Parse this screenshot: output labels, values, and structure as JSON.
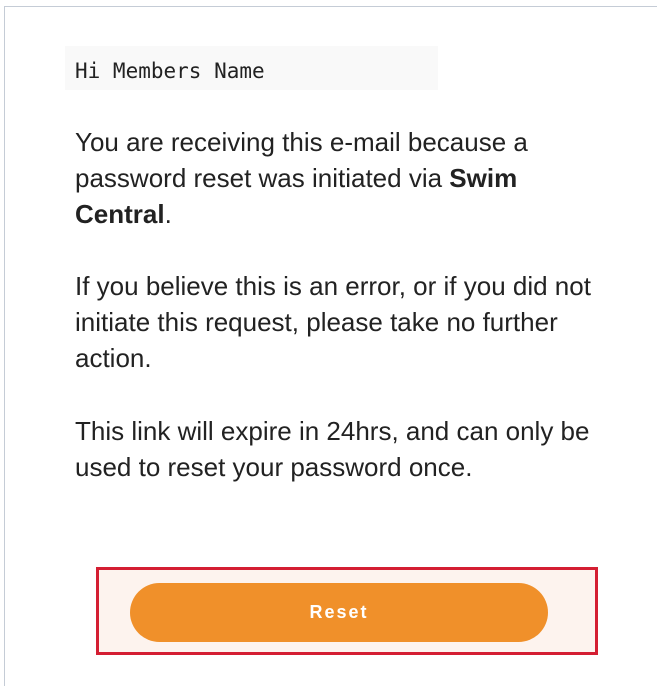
{
  "email": {
    "greeting": "Hi Members Name",
    "paragraph1": {
      "text_before": "You are receiving this e-mail because a password reset was initiated via ",
      "bold": "Swim Central",
      "text_after": "."
    },
    "paragraph2": "If you believe this is an error, or if you did not initiate this request, please take no further action.",
    "paragraph3": "This link will expire in 24hrs, and can only be used to reset your password once."
  },
  "reset_button": {
    "label": "Reset"
  },
  "colors": {
    "button": "#f0902a",
    "highlight_border": "#d41e32",
    "text": "#222222"
  }
}
